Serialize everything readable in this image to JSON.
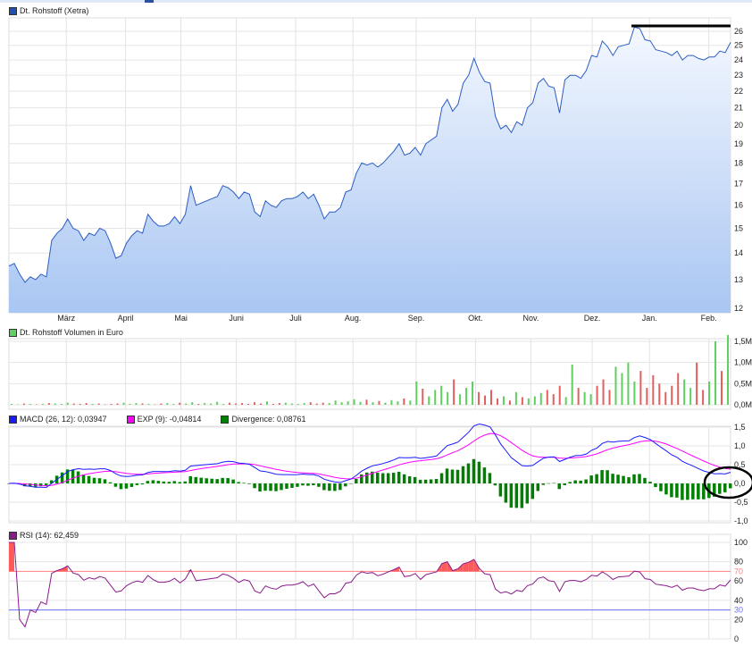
{
  "legends": {
    "price": "Dt. Rohstoff (Xetra)",
    "volume": "Dt. Rohstoff Volumen in Euro",
    "macd": "MACD (26, 12): 0,03947",
    "exp": "EXP (9): -0,04814",
    "divergence": "Divergence: 0,08761",
    "rsi": "RSI (14): 62,459"
  },
  "colors": {
    "price_line": "#2b5cc4",
    "macd": "#1a1aff",
    "exp": "#ff00ff",
    "divergence": "#008000",
    "vol_up": "#5fcf5f",
    "vol_down": "#e06060",
    "rsi": "#8b1a8b",
    "rsi70": "#ff8080",
    "rsi30": "#6a6aff",
    "annotation": "#000000"
  },
  "chart_data": {
    "type": "line",
    "title": "Dt. Rohstoff (Xetra)",
    "x_range_days": [
      0,
      365
    ],
    "months": [
      {
        "label": "März",
        "day": 29
      },
      {
        "label": "April",
        "day": 59
      },
      {
        "label": "Mai",
        "day": 87
      },
      {
        "label": "Juni",
        "day": 115
      },
      {
        "label": "Juli",
        "day": 145
      },
      {
        "label": "Aug.",
        "day": 174
      },
      {
        "label": "Sep.",
        "day": 206
      },
      {
        "label": "Okt.",
        "day": 236
      },
      {
        "label": "Nov.",
        "day": 264
      },
      {
        "label": "Dez.",
        "day": 295
      },
      {
        "label": "Jan.",
        "day": 324
      },
      {
        "label": "Feb.",
        "day": 354
      }
    ],
    "price": {
      "scale": "log",
      "ylim": [
        12,
        26
      ],
      "yticks": [
        12,
        13,
        14,
        15,
        16,
        17,
        18,
        19,
        20,
        21,
        22,
        23,
        24,
        25,
        26
      ],
      "values": [
        13.5,
        13.6,
        13.2,
        12.9,
        13.1,
        13.0,
        13.2,
        13.1,
        14.5,
        14.8,
        15.0,
        15.4,
        15.0,
        14.9,
        14.5,
        14.8,
        14.7,
        15.0,
        14.9,
        14.4,
        13.8,
        13.9,
        14.4,
        14.7,
        14.9,
        14.8,
        15.6,
        15.3,
        15.1,
        15.1,
        15.2,
        15.5,
        15.2,
        15.6,
        16.9,
        16.0,
        16.1,
        16.2,
        16.3,
        16.4,
        16.9,
        16.8,
        16.6,
        16.3,
        16.6,
        16.5,
        15.7,
        15.5,
        16.2,
        16.0,
        15.9,
        16.2,
        16.3,
        16.3,
        16.4,
        16.6,
        16.3,
        16.5,
        16.0,
        15.4,
        15.7,
        15.7,
        15.9,
        16.6,
        16.7,
        17.5,
        18.0,
        17.9,
        18.0,
        17.8,
        18.0,
        18.3,
        18.6,
        19.0,
        18.4,
        18.5,
        18.8,
        18.4,
        19.0,
        19.2,
        19.4,
        21.0,
        21.5,
        20.8,
        21.2,
        22.5,
        23.0,
        24.1,
        23.2,
        22.6,
        22.5,
        20.5,
        19.8,
        20.0,
        19.6,
        20.2,
        20.0,
        21.0,
        21.3,
        22.5,
        22.8,
        22.3,
        22.2,
        20.7,
        22.7,
        23.0,
        23.0,
        22.8,
        23.3,
        24.3,
        24.2,
        25.3,
        24.9,
        24.3,
        24.9,
        25.0,
        25.1,
        26.3,
        26.2,
        25.4,
        25.3,
        24.7,
        24.6,
        24.5,
        24.3,
        24.6,
        24.0,
        24.3,
        24.3,
        24.1,
        24.0,
        24.2,
        24.2,
        24.6,
        24.5,
        25.2
      ]
    },
    "volume": {
      "unit": "M EUR",
      "ylim": [
        0,
        1.5
      ],
      "yticks": [
        {
          "v": 0,
          "label": "0,0M"
        },
        {
          "v": 0.5,
          "label": "0,5M"
        },
        {
          "v": 1.0,
          "label": "1,0M"
        },
        {
          "v": 1.5,
          "label": "1,5M"
        }
      ],
      "values": [
        0.02,
        0.01,
        0.03,
        0.02,
        0.01,
        0.02,
        0.04,
        0.03,
        0.02,
        0.05,
        0.03,
        0.02,
        0.04,
        0.02,
        0.03,
        0.01,
        0.02,
        0.03,
        0.05,
        0.02,
        0.04,
        0.03,
        0.02,
        0.01,
        0.03,
        0.04,
        0.02,
        0.05,
        0.03,
        0.06,
        0.02,
        0.04,
        0.03,
        0.07,
        0.02,
        0.05,
        0.03,
        0.04,
        0.02,
        0.06,
        0.03,
        0.08,
        0.02,
        0.04,
        0.05,
        0.03,
        0.02,
        0.04,
        0.06,
        0.03,
        0.05,
        0.04,
        0.1,
        0.06,
        0.08,
        0.13,
        0.07,
        0.12,
        0.06,
        0.09,
        0.05,
        0.11,
        0.08,
        0.15,
        0.1,
        0.55,
        0.38,
        0.2,
        0.35,
        0.45,
        0.3,
        0.6,
        0.25,
        0.4,
        0.55,
        0.3,
        0.22,
        0.35,
        0.15,
        0.2,
        0.1,
        0.3,
        0.18,
        0.15,
        0.2,
        0.28,
        0.35,
        0.25,
        0.45,
        0.18,
        0.95,
        0.4,
        0.3,
        0.25,
        0.45,
        0.6,
        0.35,
        0.9,
        0.75,
        1.0,
        0.55,
        0.8,
        0.4,
        0.7,
        0.5,
        0.3,
        0.45,
        0.75,
        0.6,
        0.4,
        1.0,
        0.35,
        0.55,
        1.5,
        0.8,
        1.65
      ]
    },
    "macd": {
      "fast": 12,
      "slow": 26,
      "signal": 9,
      "ylim": [
        -1.0,
        1.5
      ],
      "yticks": [
        {
          "v": 1.5,
          "label": "1,5"
        },
        {
          "v": 1.0,
          "label": "1,0"
        },
        {
          "v": 0.5,
          "label": "0,5"
        },
        {
          "v": 0,
          "label": "0,0"
        },
        {
          "v": -0.5,
          "label": "-0,5"
        },
        {
          "v": -1.0,
          "label": "-1,0"
        }
      ]
    },
    "rsi": {
      "period": 14,
      "ylim": [
        0,
        100
      ],
      "yticks": [
        {
          "v": 100,
          "label": "100"
        },
        {
          "v": 80,
          "label": "80"
        },
        {
          "v": 60,
          "label": "60"
        },
        {
          "v": 40,
          "label": "40"
        },
        {
          "v": 20,
          "label": "20"
        },
        {
          "v": 0,
          "label": "0"
        }
      ],
      "levels": [
        {
          "v": 70,
          "label": "70"
        },
        {
          "v": 30,
          "label": "30"
        }
      ]
    }
  }
}
